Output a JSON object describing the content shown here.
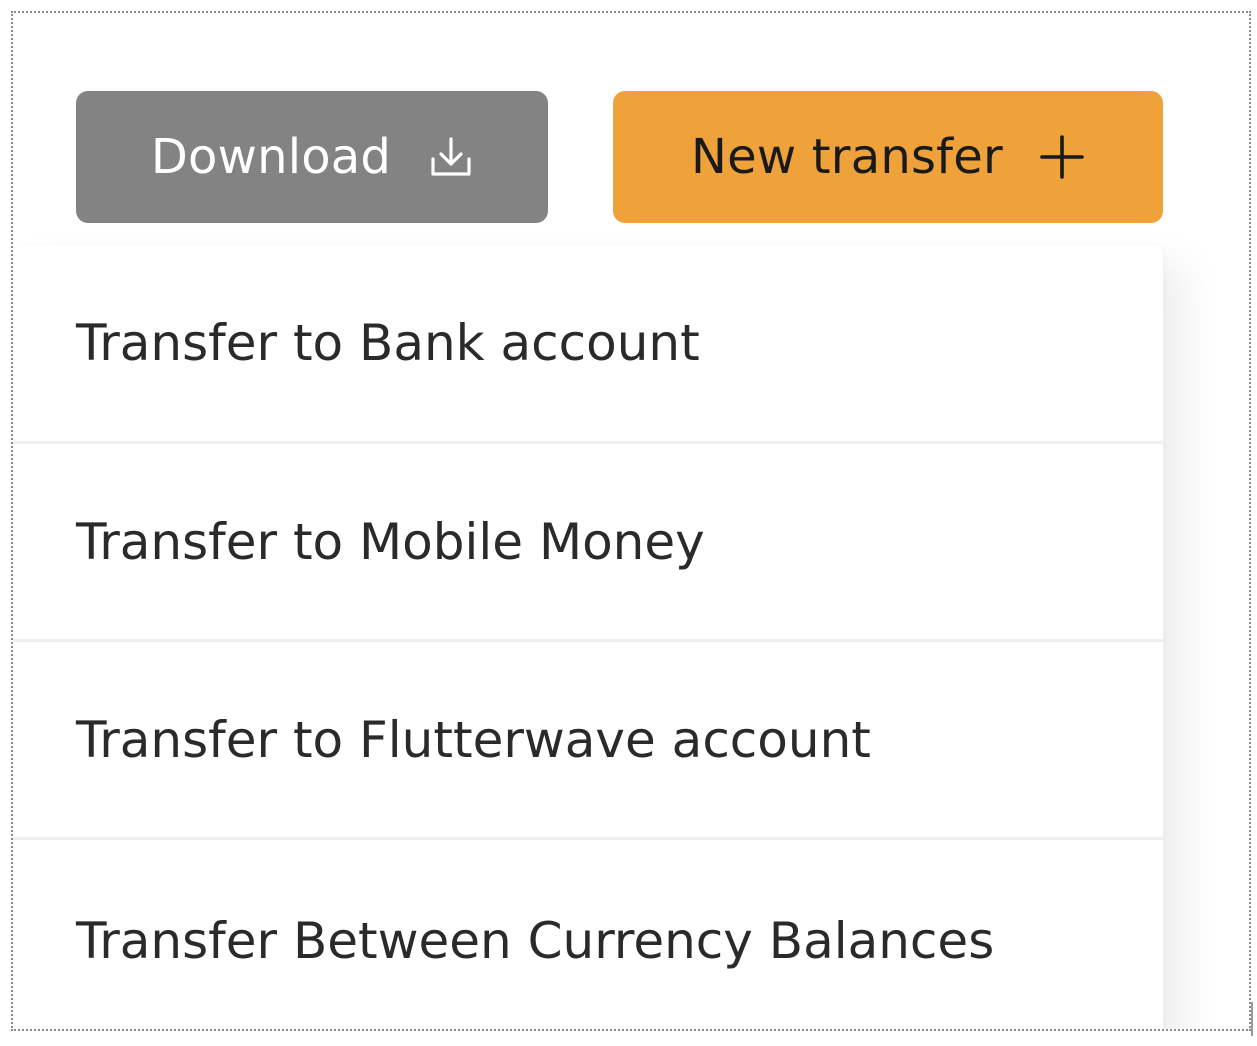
{
  "toolbar": {
    "download_label": "Download",
    "download_icon": "download-icon",
    "new_transfer_label": "New transfer",
    "new_transfer_icon": "plus-icon"
  },
  "menu": {
    "items": [
      {
        "label": "Transfer to Bank account"
      },
      {
        "label": "Transfer to Mobile Money"
      },
      {
        "label": "Transfer to Flutterwave account"
      },
      {
        "label": "Transfer Between Currency Balances"
      }
    ]
  },
  "colors": {
    "download_bg": "#838383",
    "new_transfer_bg": "#f0a23a",
    "text": "#2a2a2a",
    "divider": "#efefef"
  }
}
